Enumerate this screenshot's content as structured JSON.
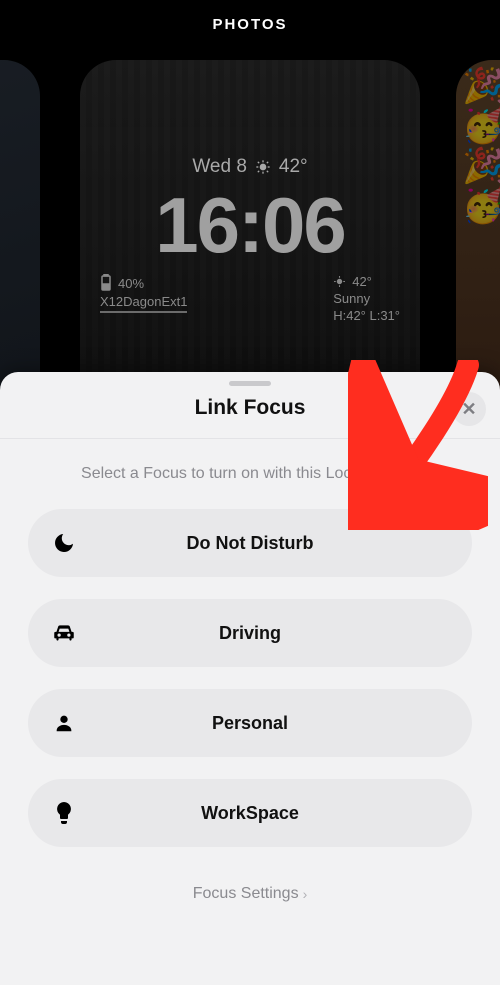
{
  "topbar": {
    "title": "PHOTOS"
  },
  "lockscreen": {
    "date_day": "Wed 8",
    "date_temp": "42°",
    "time": "16:06",
    "battery_pct": "40%",
    "network_name": "X12DagonExt1",
    "weather_temp": "42°",
    "weather_cond": "Sunny",
    "weather_range": "H:42° L:31°"
  },
  "sheet": {
    "title": "Link Focus",
    "subtitle": "Select a Focus to turn on with this Lock Screen.",
    "close_glyph": "✕",
    "items": [
      {
        "label": "Do Not Disturb",
        "icon": "moon-icon"
      },
      {
        "label": "Driving",
        "icon": "car-icon"
      },
      {
        "label": "Personal",
        "icon": "person-icon"
      },
      {
        "label": "WorkSpace",
        "icon": "bulb-icon"
      }
    ],
    "settings_label": "Focus Settings",
    "settings_chevron": "›"
  }
}
